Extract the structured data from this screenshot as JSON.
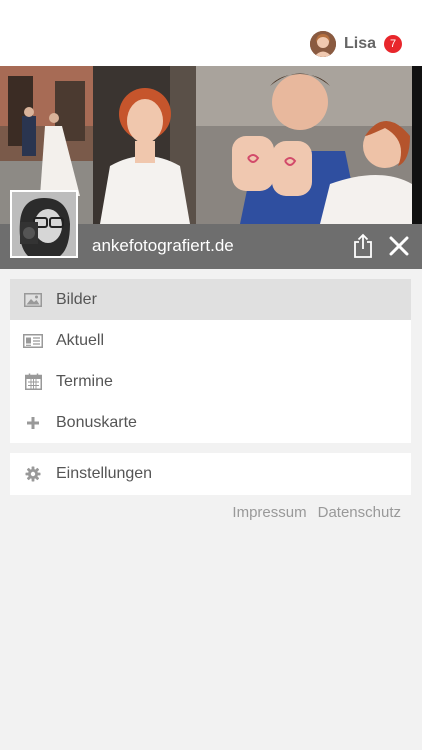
{
  "user": {
    "name": "Lisa",
    "notification_count": "7",
    "avatar_icon": "user-avatar"
  },
  "site": {
    "name": "ankefotografiert.de"
  },
  "menu": {
    "items": [
      {
        "label": "Bilder",
        "icon": "image-icon",
        "active": true
      },
      {
        "label": "Aktuell",
        "icon": "newspaper-icon",
        "active": false
      },
      {
        "label": "Termine",
        "icon": "calendar-icon",
        "active": false
      },
      {
        "label": "Bonuskarte",
        "icon": "plus-icon",
        "active": false
      }
    ],
    "settings_label": "Einstellungen",
    "settings_icon": "gear-icon"
  },
  "footer": {
    "impressum": "Impressum",
    "datenschutz": "Datenschutz"
  },
  "colors": {
    "badge": "#e8262b",
    "caption_bar": "#6e6e6e",
    "active_item": "#e0e0e0",
    "background": "#f2f2f2"
  }
}
